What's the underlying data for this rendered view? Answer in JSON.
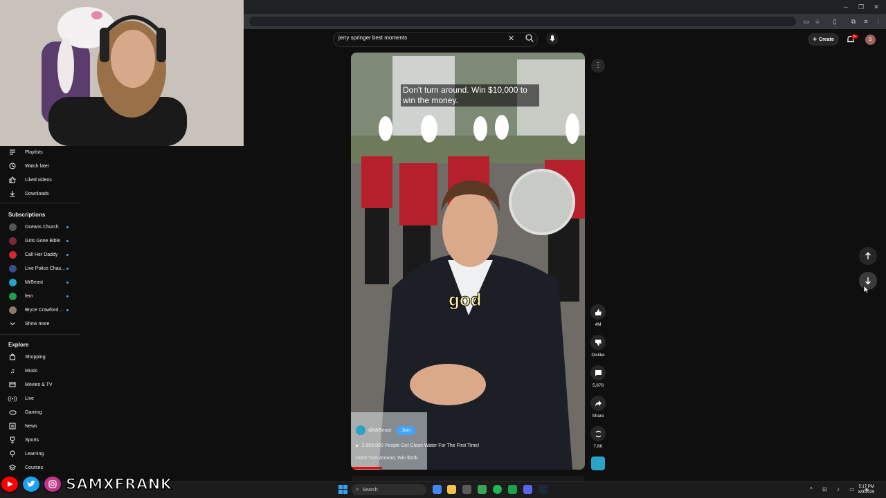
{
  "search": {
    "query": "jerry springer best moments"
  },
  "header": {
    "create_label": "Create",
    "notif_badge": "9+",
    "avatar_initial": "S"
  },
  "sidebar": {
    "you_items": [
      {
        "label": "Playlists",
        "icon": "playlist-icon"
      },
      {
        "label": "Watch later",
        "icon": "clock-icon"
      },
      {
        "label": "Liked videos",
        "icon": "thumbs-up-icon"
      },
      {
        "label": "Downloads",
        "icon": "download-icon"
      }
    ],
    "subscriptions_title": "Subscriptions",
    "subscriptions": [
      {
        "label": "Oceans Church",
        "color": "#555555"
      },
      {
        "label": "Girls Gone Bible",
        "color": "#7a2a3a"
      },
      {
        "label": "Call Her Daddy",
        "color": "#d6262e"
      },
      {
        "label": "Live Police Chas...",
        "color": "#3a4a8a"
      },
      {
        "label": "MrBeast",
        "color": "#29a3c7"
      },
      {
        "label": "fem",
        "color": "#1e9e4a"
      },
      {
        "label": "Bryce Crawford ...",
        "color": "#8a7a6a"
      }
    ],
    "show_more": "Show more",
    "explore_title": "Explore",
    "explore": [
      {
        "label": "Shopping",
        "icon": "shopping-bag-icon"
      },
      {
        "label": "Music",
        "icon": "music-note-icon"
      },
      {
        "label": "Movies & TV",
        "icon": "film-icon"
      },
      {
        "label": "Live",
        "icon": "live-icon"
      },
      {
        "label": "Gaming",
        "icon": "gamepad-icon"
      },
      {
        "label": "News",
        "icon": "newspaper-icon"
      },
      {
        "label": "Sports",
        "icon": "trophy-icon"
      },
      {
        "label": "Learning",
        "icon": "bulb-icon"
      },
      {
        "label": "Courses",
        "icon": "layers-icon"
      }
    ]
  },
  "short": {
    "caption_top": "Don't turn around. Win $10,000 to win the money.",
    "caption_word": "god",
    "channel": "@MrBeast",
    "join_label": "Join",
    "linked_video": "2,000,000 People Get Clean Water For The First Time!",
    "title": "Don't Turn Around, Win $10k"
  },
  "actions": {
    "like_count": "4M",
    "dislike_label": "Dislike",
    "comment_count": "5,878",
    "share_label": "Share",
    "remix_count": "7.8K"
  },
  "taskbar": {
    "search_placeholder": "Search",
    "time": "5:17 PM",
    "date": "8/9/2025"
  },
  "overlay": {
    "handle": "SAMXFRANK"
  }
}
